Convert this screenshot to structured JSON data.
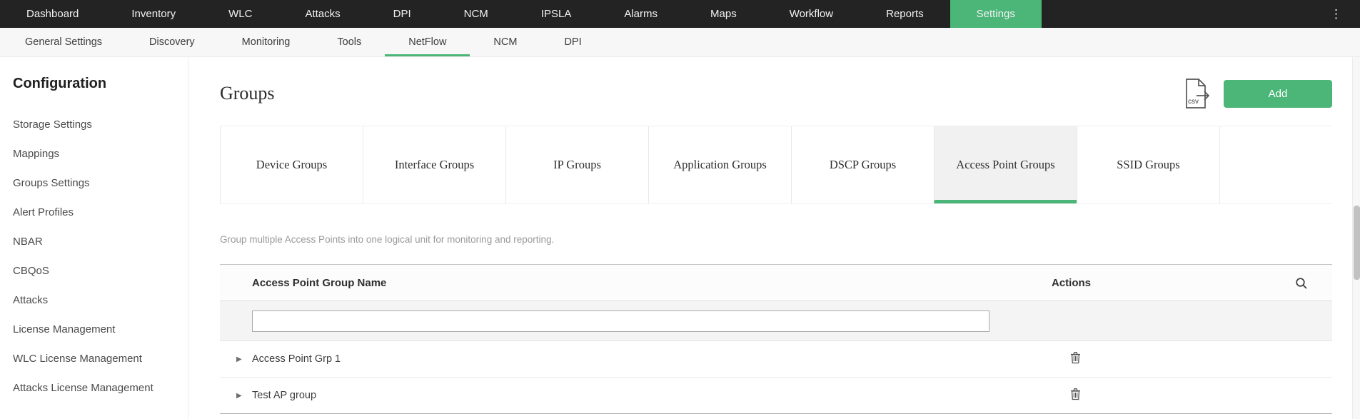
{
  "colors": {
    "accent": "#4cb578",
    "topnav_bg": "#232323"
  },
  "top_nav": {
    "items": [
      "Dashboard",
      "Inventory",
      "WLC",
      "Attacks",
      "DPI",
      "NCM",
      "IPSLA",
      "Alarms",
      "Maps",
      "Workflow",
      "Reports",
      "Settings"
    ],
    "active_item": "Settings",
    "more_menu": "⋮"
  },
  "sub_nav": {
    "items": [
      "General Settings",
      "Discovery",
      "Monitoring",
      "Tools",
      "NetFlow",
      "NCM",
      "DPI"
    ],
    "active_item": "NetFlow"
  },
  "sidebar": {
    "title": "Configuration",
    "items": [
      "Storage Settings",
      "Mappings",
      "Groups Settings",
      "Alert Profiles",
      "NBAR",
      "CBQoS",
      "Attacks",
      "License Management",
      "WLC License Management",
      "Attacks License Management"
    ]
  },
  "main": {
    "title": "Groups",
    "csv_icon": "csv-export-icon",
    "add_button_label": "Add",
    "tabs": [
      "Device Groups",
      "Interface Groups",
      "IP Groups",
      "Application Groups",
      "DSCP Groups",
      "Access Point Groups",
      "SSID Groups"
    ],
    "active_tab": "Access Point Groups",
    "description": "Group multiple Access Points into one logical unit for monitoring and reporting.",
    "table": {
      "columns": [
        "Access Point Group Name",
        "Actions"
      ],
      "filter_value": "",
      "rows": [
        "Access Point Grp 1",
        "Test AP group"
      ],
      "caret_glyph": "▶"
    }
  }
}
